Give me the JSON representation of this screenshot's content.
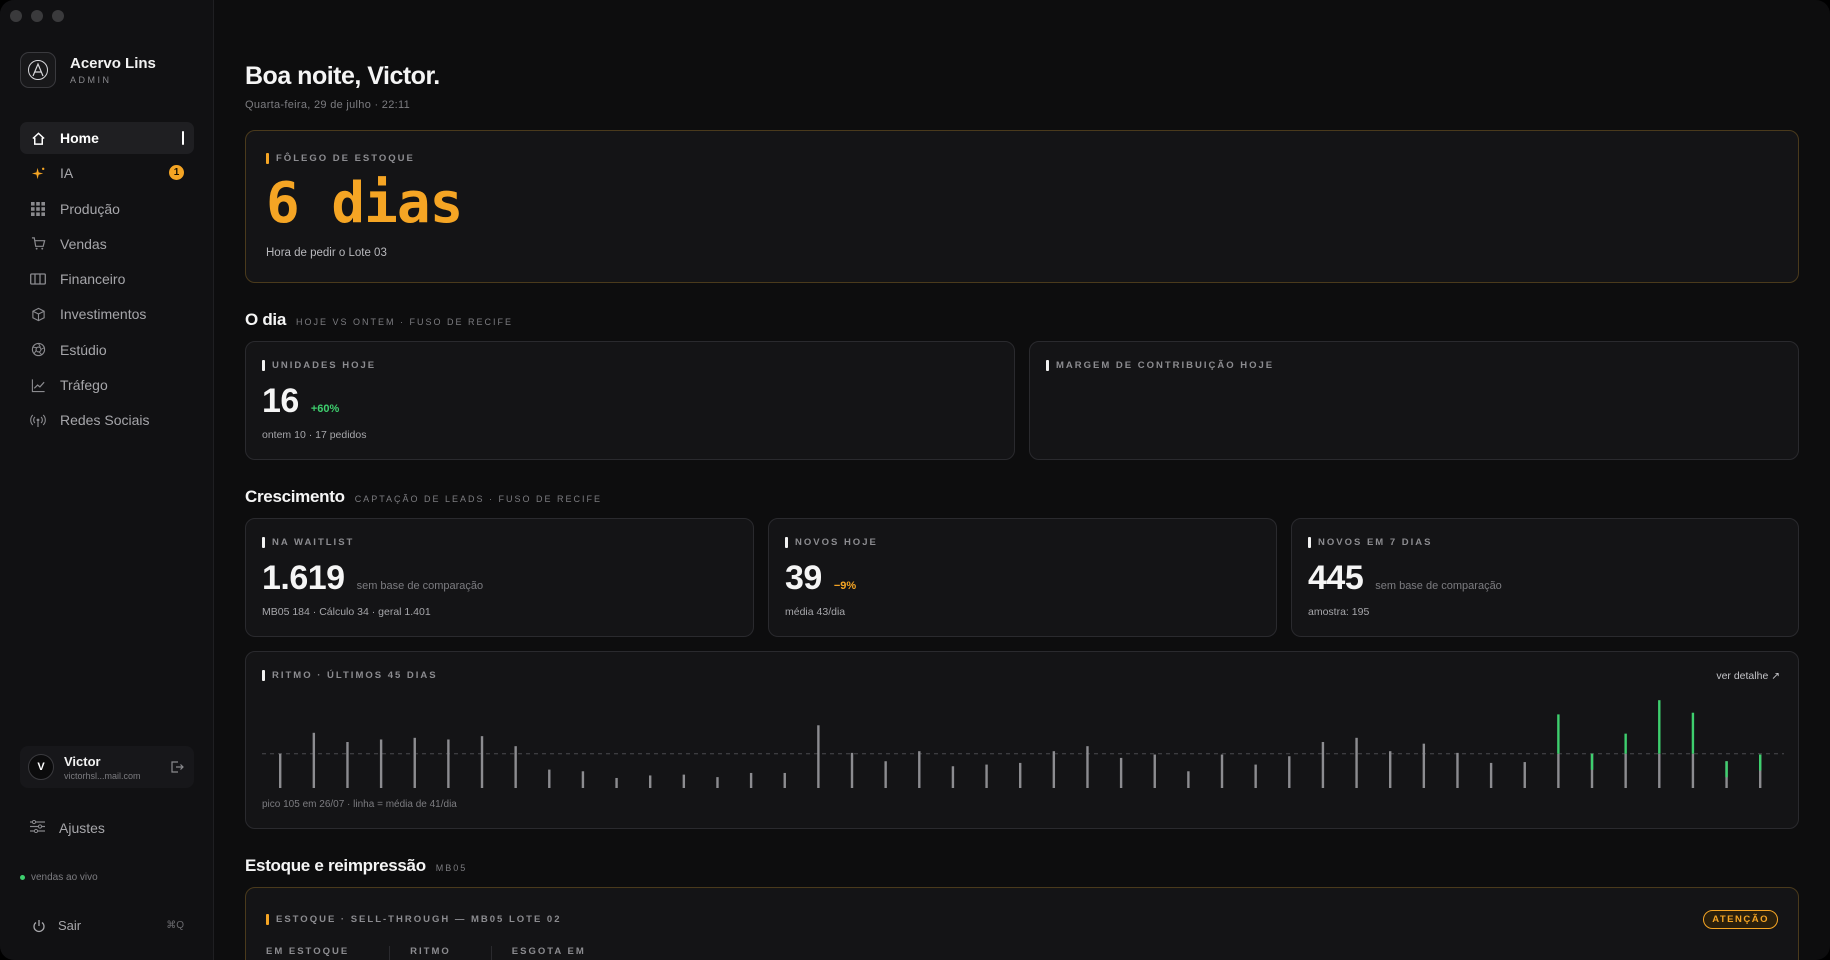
{
  "brand": {
    "name": "Acervo Lins",
    "role": "ADMIN"
  },
  "nav": [
    {
      "label": "Home",
      "icon": "home-icon",
      "active": true
    },
    {
      "label": "IA",
      "icon": "sparkle-icon",
      "badge": "1"
    },
    {
      "label": "Produção",
      "icon": "grid-icon"
    },
    {
      "label": "Vendas",
      "icon": "cart-icon"
    },
    {
      "label": "Financeiro",
      "icon": "wallet-icon"
    },
    {
      "label": "Investimentos",
      "icon": "cube-icon"
    },
    {
      "label": "Estúdio",
      "icon": "aperture-icon"
    },
    {
      "label": "Tráfego",
      "icon": "trend-icon"
    },
    {
      "label": "Redes Sociais",
      "icon": "broadcast-icon"
    }
  ],
  "user": {
    "initial": "V",
    "name": "Victor",
    "email": "victorhsl...mail.com"
  },
  "settings_label": "Ajustes",
  "live_label": "vendas ao vivo",
  "logout": {
    "label": "Sair",
    "shortcut": "⌘Q"
  },
  "header": {
    "greeting": "Boa noite, Victor.",
    "date": "Quarta-feira, 29 de julho · 22:11"
  },
  "stock_breath": {
    "label": "FÔLEGO DE ESTOQUE",
    "value": "6 dias",
    "note": "Hora de pedir o Lote 03"
  },
  "section_day": {
    "title": "O dia",
    "subtitle": "HOJE VS ONTEM · FUSO DE RECIFE"
  },
  "units_today": {
    "label": "UNIDADES HOJE",
    "value": "16",
    "delta": "+60%",
    "sub": "ontem 10 · 17 pedidos"
  },
  "margin_today": {
    "label": "MARGEM DE CONTRIBUIÇÃO HOJE"
  },
  "section_growth": {
    "title": "Crescimento",
    "subtitle": "CAPTAÇÃO DE LEADS · FUSO DE RECIFE"
  },
  "waitlist": {
    "label": "NA WAITLIST",
    "value": "1.619",
    "note": "sem base de comparação",
    "sub": "MB05 184 · Cálculo 34 · geral 1.401"
  },
  "new_today": {
    "label": "NOVOS HOJE",
    "value": "39",
    "delta": "−9%",
    "sub": "média 43/dia"
  },
  "new_7d": {
    "label": "NOVOS EM 7 DIAS",
    "value": "445",
    "note": "sem base de comparação",
    "sub": "amostra: 195"
  },
  "rhythm": {
    "label": "RITMO · ÚLTIMOS 45 DIAS",
    "link": "ver detalhe ↗",
    "footer": "pico 105 em 26/07 · linha = média de 41/dia"
  },
  "chart_data": {
    "type": "bar",
    "title": "RITMO · ÚLTIMOS 45 DIAS",
    "average": 41,
    "peak": {
      "value": 105,
      "date": "26/07"
    },
    "values": [
      41,
      66,
      55,
      58,
      60,
      58,
      62,
      50,
      22,
      20,
      12,
      15,
      16,
      13,
      18,
      18,
      75,
      42,
      32,
      44,
      26,
      28,
      30,
      44,
      50,
      36,
      40,
      20,
      40,
      28,
      38,
      55,
      60,
      44,
      53,
      42,
      30,
      31,
      88,
      41,
      65,
      105,
      90,
      32,
      40
    ],
    "highlight_from_index": 38
  },
  "section_stock": {
    "title": "Estoque e reimpressão",
    "subtitle": "MB05"
  },
  "sell_through": {
    "label": "ESTOQUE · SELL-THROUGH — MB05 LOTE 02",
    "status": "ATENÇÃO",
    "columns": [
      "EM ESTOQUE",
      "RITMO",
      "ESGOTA EM"
    ]
  },
  "colors": {
    "accent": "#f5a524",
    "positive": "#3ecf6e",
    "background": "#0d0d0e",
    "card": "#141416"
  }
}
